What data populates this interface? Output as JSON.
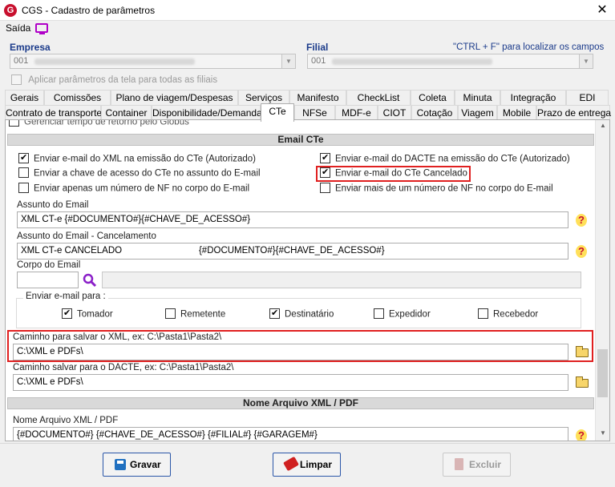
{
  "window": {
    "logo": "G",
    "title": "CGS - Cadastro de parâmetros",
    "close": "✕",
    "menu_saida": "Saída"
  },
  "empresa": {
    "label": "Empresa",
    "value": "001",
    "dropdown": "▼"
  },
  "filial": {
    "label": "Filial",
    "value": "001",
    "dropdown": "▼"
  },
  "hint": "\"CTRL + F\" para localizar os campos",
  "apply_all": "Aplicar parâmetros da tela para todas as filiais",
  "tabs_row1": [
    "Gerais",
    "Comissões",
    "Plano de viagem/Despesas",
    "Serviços",
    "Manifesto",
    "CheckList",
    "Coleta",
    "Minuta",
    "Integração",
    "EDI"
  ],
  "tabs_row2": [
    "Contrato de transporte",
    "Container",
    "Disponibilidade/Demanda",
    "CTe",
    "NFSe",
    "MDF-e",
    "CIOT",
    "Cotação",
    "Viagem",
    "Mobile",
    "Prazo de entrega"
  ],
  "cut_option": "Gerenciar tempo de retorno pelo Globus",
  "email_section": {
    "title": "Email CTe",
    "left_options": [
      {
        "label": "Enviar e-mail do XML na emissão do CTe (Autorizado)",
        "checked": true
      },
      {
        "label": "Enviar a chave de acesso do CTe no assunto do E-mail",
        "checked": false
      },
      {
        "label": "Enviar apenas um número de NF no corpo do E-mail",
        "checked": false
      }
    ],
    "right_options": [
      {
        "label": "Enviar e-mail do DACTE na emissão do CTe (Autorizado)",
        "checked": true
      },
      {
        "label": "Enviar e-mail do CTe Cancelado",
        "checked": true
      },
      {
        "label": "Enviar mais de um número de NF no corpo do E-mail",
        "checked": false
      }
    ],
    "assunto_label": "Assunto do Email",
    "assunto_value": "XML CT-e {#DOCUMENTO#}{#CHAVE_DE_ACESSO#}",
    "assunto_cancel_label": "Assunto do Email - Cancelamento",
    "assunto_cancel_value": "XML CT-e CANCELADO                              {#DOCUMENTO#}{#CHAVE_DE_ACESSO#}",
    "corpo_label": "Corpo do Email",
    "help": "?",
    "enviar_para_label": "Enviar e-mail para :",
    "recipients": [
      {
        "label": "Tomador",
        "checked": true
      },
      {
        "label": "Remetente",
        "checked": false
      },
      {
        "label": "Destinatário",
        "checked": true
      },
      {
        "label": "Expedidor",
        "checked": false
      },
      {
        "label": "Recebedor",
        "checked": false
      }
    ],
    "xml_path_label": "Caminho para salvar o XML, ex: C:\\Pasta1\\Pasta2\\",
    "xml_path_value": "C:\\XML e PDFs\\",
    "dacte_path_label": "Caminho salvar para o DACTE, ex: C:\\Pasta1\\Pasta2\\",
    "dacte_path_value": "C:\\XML e PDFs\\"
  },
  "file_section": {
    "title": "Nome Arquivo XML / PDF",
    "name_label": "Nome Arquivo XML / PDF",
    "name_value": "{#DOCUMENTO#} {#CHAVE_DE_ACESSO#} {#FILIAL#} {#GARAGEM#}"
  },
  "scroll": {
    "up": "▲",
    "down": "▼"
  },
  "buttons": {
    "gravar": "Gravar",
    "limpar": "Limpar",
    "excluir": "Excluir"
  }
}
